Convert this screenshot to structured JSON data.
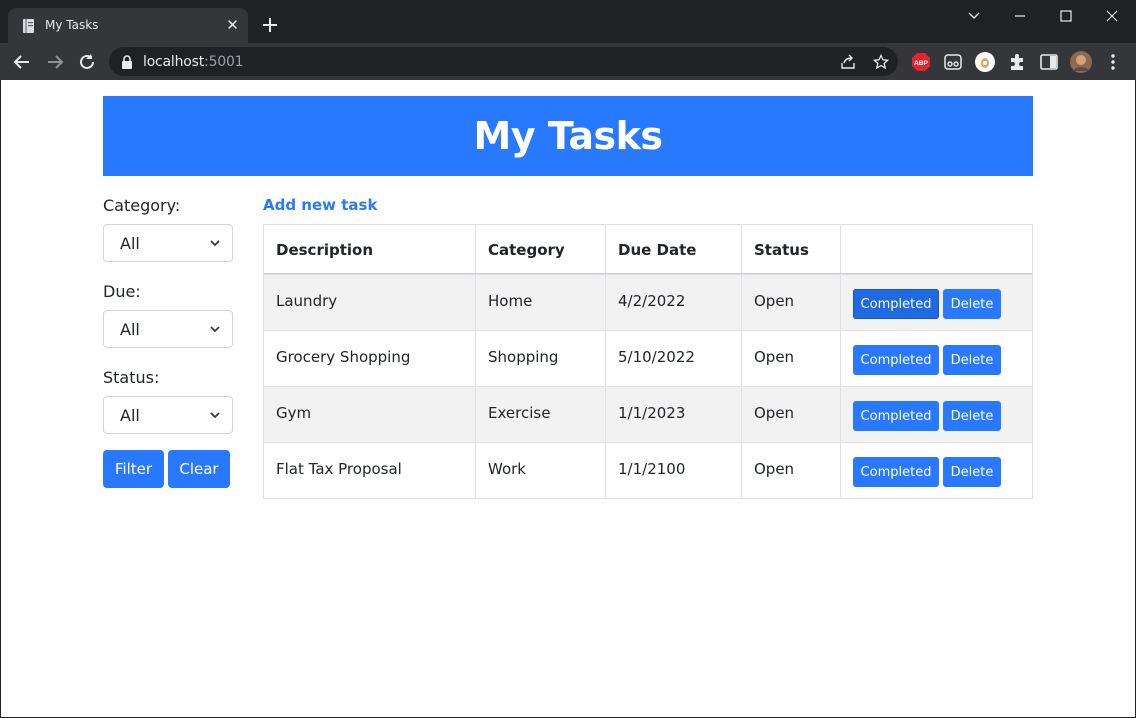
{
  "browser": {
    "tab_title": "My Tasks",
    "url_host": "localhost",
    "url_port": ":5001",
    "colors": {
      "chrome_dark": "#202124",
      "chrome_tab": "#35363a"
    }
  },
  "page": {
    "title": "My Tasks",
    "add_task_label": "Add new task",
    "accent_color": "#2979ff",
    "filters": {
      "category_label": "Category:",
      "category_value": "All",
      "due_label": "Due:",
      "due_value": "All",
      "status_label": "Status:",
      "status_value": "All",
      "filter_button": "Filter",
      "clear_button": "Clear"
    },
    "table": {
      "headers": [
        "Description",
        "Category",
        "Due Date",
        "Status",
        ""
      ],
      "rows": [
        {
          "description": "Laundry",
          "category": "Home",
          "due_date": "4/2/2022",
          "status": "Open"
        },
        {
          "description": "Grocery Shopping",
          "category": "Shopping",
          "due_date": "5/10/2022",
          "status": "Open"
        },
        {
          "description": "Gym",
          "category": "Exercise",
          "due_date": "1/1/2023",
          "status": "Open"
        },
        {
          "description": "Flat Tax Proposal",
          "category": "Work",
          "due_date": "1/1/2100",
          "status": "Open"
        }
      ],
      "completed_label": "Completed",
      "delete_label": "Delete"
    }
  }
}
